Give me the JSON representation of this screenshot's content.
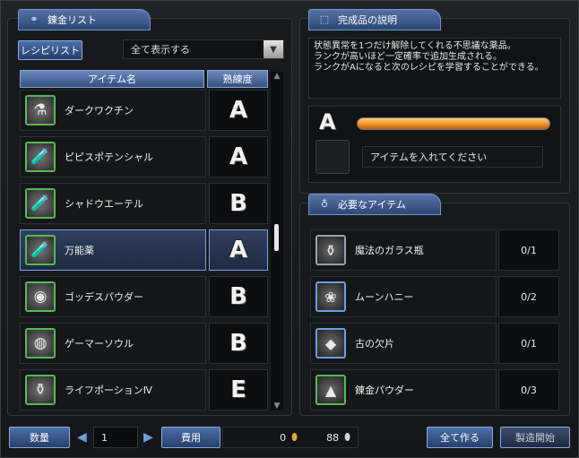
{
  "left_tab": {
    "title": "錬金リスト"
  },
  "recipe_button": "レシピリスト",
  "filter": {
    "selected": "全て表示する"
  },
  "columns": {
    "name": "アイテム名",
    "proficiency": "熟練度"
  },
  "recipes": [
    {
      "name": "ダークワクチン",
      "rank": "A",
      "icon": "purple-flask-icon",
      "glyph": "⚗"
    },
    {
      "name": "ピピスポテンシャル",
      "rank": "A",
      "icon": "green-potion-icon",
      "glyph": "🧪"
    },
    {
      "name": "シャドウエーテル",
      "rank": "B",
      "icon": "purple-potion-icon",
      "glyph": "🧪"
    },
    {
      "name": "万能薬",
      "rank": "A",
      "icon": "red-potion-icon",
      "glyph": "🧪"
    },
    {
      "name": "ゴッデスパウダー",
      "rank": "B",
      "icon": "powder-dish-icon",
      "glyph": "◉"
    },
    {
      "name": "ゲーマーソウル",
      "rank": "B",
      "icon": "orb-icon",
      "glyph": "◍"
    },
    {
      "name": "ライフポーションⅣ",
      "rank": "E",
      "icon": "life-potion-icon",
      "glyph": "⚱"
    }
  ],
  "selected_index": 3,
  "product": {
    "tab_title": "完成品の説明",
    "description": [
      "状態異常を1つだけ解除してくれる不思議な薬品。",
      "ランクが高いほど一定確率で追加生成される。",
      "ランクがAになると次のレシピを学習することができる。"
    ],
    "rank": "A",
    "progress": 1.0,
    "item_prompt": "アイテムを入れてください"
  },
  "materials": {
    "tab_title": "必要なアイテム",
    "items": [
      {
        "name": "魔法のガラス瓶",
        "count": "0/1",
        "icon": "glass-bottle-icon",
        "glyph": "⚱"
      },
      {
        "name": "ムーンハニー",
        "count": "0/2",
        "icon": "rose-icon",
        "glyph": "❀"
      },
      {
        "name": "古の欠片",
        "count": "0/1",
        "icon": "crystal-icon",
        "glyph": "◆"
      },
      {
        "name": "錬金パウダー",
        "count": "0/3",
        "icon": "powder-pile-icon",
        "glyph": "▲"
      }
    ]
  },
  "footer": {
    "quantity_label": "数量",
    "quantity": "1",
    "cost_label": "費用",
    "cost": "0",
    "money": "88",
    "make_all": "全て作る",
    "start": "製造開始"
  },
  "colors": {
    "accent_blue": "#4c6fa8",
    "progress_orange": "#f0902a",
    "rank_text": "#f2f2f2"
  }
}
